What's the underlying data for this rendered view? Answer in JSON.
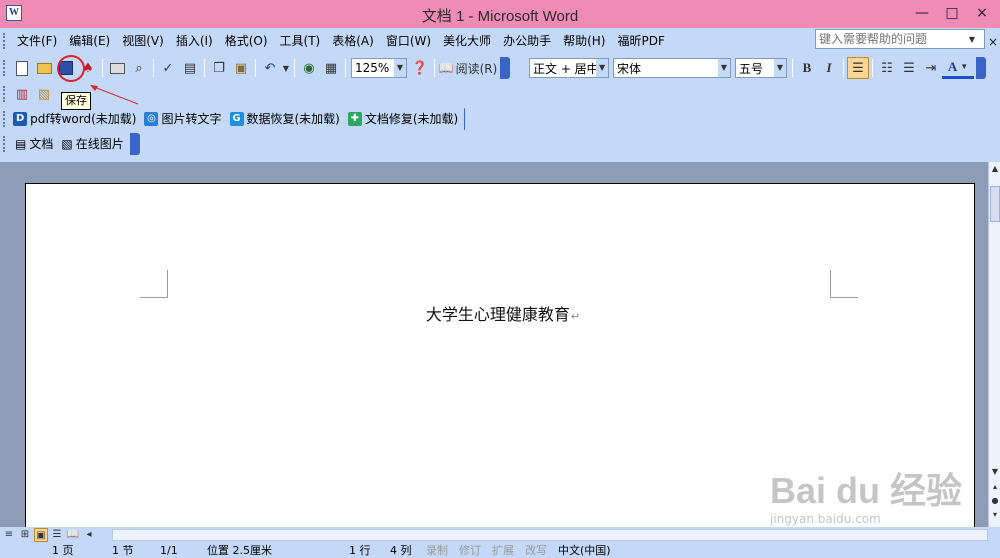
{
  "window": {
    "title": "文档 1 - Microsoft Word",
    "min": "—",
    "max": "□",
    "close": "×"
  },
  "menu": {
    "items": [
      "文件(F)",
      "编辑(E)",
      "视图(V)",
      "插入(I)",
      "格式(O)",
      "工具(T)",
      "表格(A)",
      "窗口(W)",
      "美化大师",
      "办公助手",
      "帮助(H)",
      "福昕PDF"
    ],
    "help_placeholder": "键入需要帮助的问题",
    "close_doc": "×"
  },
  "standard_toolbar": {
    "zoom": "125%",
    "read_label": "阅读(R)",
    "icons": [
      "new-document-icon",
      "open-folder-icon",
      "save-icon",
      "permission-icon",
      "print-icon",
      "print-preview-icon",
      "spelling-icon",
      "research-icon",
      "copy-icon",
      "paste-icon",
      "undo-icon",
      "hyperlink-icon",
      "table-icon",
      "help-icon",
      "read-icon"
    ]
  },
  "formatting_toolbar": {
    "style": "正文 + 居中",
    "font": "宋体",
    "size": "五号",
    "bold": "B",
    "italic": "I",
    "font_color_label": "A"
  },
  "tooltip": {
    "text": "保存"
  },
  "plugin_toolbar": {
    "items": [
      {
        "icon": "D",
        "label": "pdf转word(未加载)",
        "color": "#1e5ab4"
      },
      {
        "icon": "◎",
        "label": "图片转文字",
        "color": "#2b7fd6"
      },
      {
        "icon": "G",
        "label": "数据恢复(未加载)",
        "color": "#1c8fe0"
      },
      {
        "icon": "✚",
        "label": "文档修复(未加载)",
        "color": "#2aa860"
      }
    ]
  },
  "doc_toolbar": {
    "items": [
      "文档",
      "在线图片"
    ]
  },
  "document": {
    "text": "大学生心理健康教育",
    "para_mark": "↵"
  },
  "status": {
    "page": "1 页",
    "section": "1 节",
    "pages": "1/1",
    "position": "位置 2.5厘米",
    "line": "1 行",
    "col": "4 列",
    "rec": "录制",
    "trk": "修订",
    "ext": "扩展",
    "ovr": "改写",
    "lang": "中文(中国)"
  },
  "watermark": {
    "main": "Bai du 经验",
    "sub": "jingyan.baidu.com"
  },
  "colors": {
    "title_bar": "#f08cb4",
    "command_bar": "#c3d9f7",
    "doc_background": "#8f9cb8",
    "highlight_red": "#e0202a"
  }
}
